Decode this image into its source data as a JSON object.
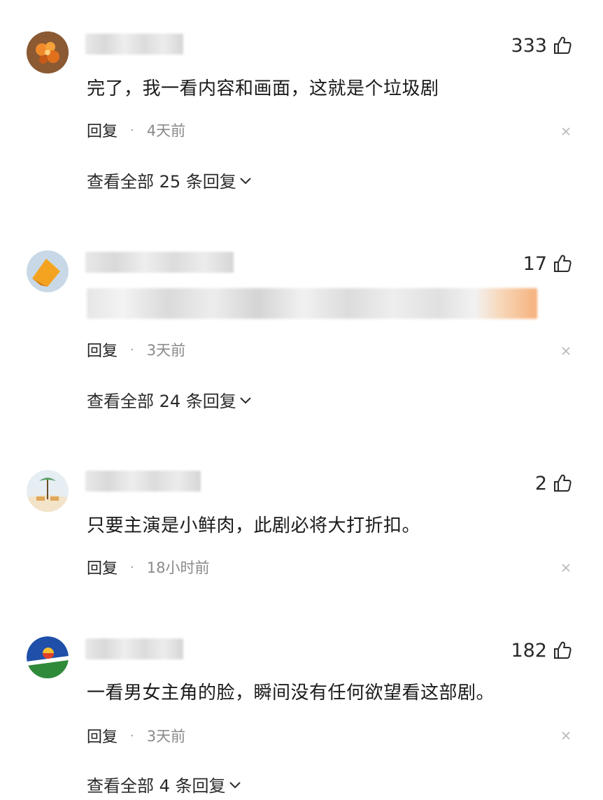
{
  "comments": [
    {
      "likes": "333",
      "content": "完了，我一看内容和画面，这就是个垃圾剧",
      "reply_label": "回复",
      "separator": "·",
      "time": "4天前",
      "view_all": "查看全部 25 条回复"
    },
    {
      "likes": "17",
      "content": "",
      "reply_label": "回复",
      "separator": "·",
      "time": "3天前",
      "view_all": "查看全部 24 条回复"
    },
    {
      "likes": "2",
      "content": "只要主演是小鲜肉，此剧必将大打折扣。",
      "reply_label": "回复",
      "separator": "·",
      "time": "18小时前",
      "view_all": ""
    },
    {
      "likes": "182",
      "content": "一看男女主角的脸，瞬间没有任何欲望看这部剧。",
      "reply_label": "回复",
      "separator": "·",
      "time": "3天前",
      "view_all": "查看全部 4 条回复"
    }
  ],
  "icons": {
    "like": "thumbs-up-icon",
    "close": "close-icon",
    "expand": "chevron-down-icon"
  },
  "colors": {
    "text": "#1a1a1a",
    "muted": "#8a8a8a",
    "close": "#b8b8b8"
  }
}
